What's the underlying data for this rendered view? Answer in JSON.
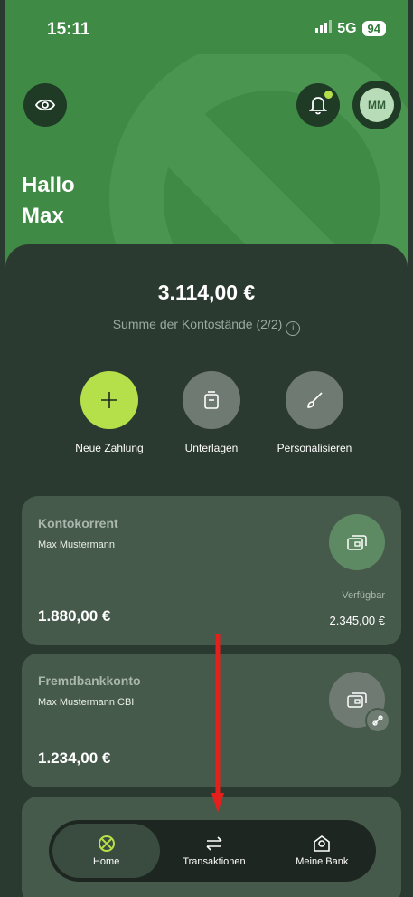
{
  "status": {
    "time": "15:11",
    "network": "5G",
    "battery": "94"
  },
  "header": {
    "avatar_initials": "MM",
    "greeting_line1": "Hallo",
    "greeting_line2": "Max"
  },
  "summary": {
    "total": "3.114,00 €",
    "label": "Summe der Kontostände (2/2)"
  },
  "actions": [
    {
      "label": "Neue Zahlung",
      "icon": "plus-icon"
    },
    {
      "label": "Unterlagen",
      "icon": "documents-icon"
    },
    {
      "label": "Personalisieren",
      "icon": "brush-icon"
    }
  ],
  "accounts": [
    {
      "title": "Kontokorrent",
      "owner": "Max Mustermann",
      "amount": "1.880,00 €",
      "available_label": "Verfügbar",
      "available_value": "2.345,00 €",
      "icon": "account-card-icon"
    },
    {
      "title": "Fremdbankkonto",
      "owner": "Max Mustermann CBI",
      "amount": "1.234,00 €",
      "icon": "account-card-icon",
      "badge_icon": "link-icon"
    }
  ],
  "nav": [
    {
      "label": "Home",
      "icon": "home-logo-icon",
      "active": true
    },
    {
      "label": "Transaktionen",
      "icon": "transfer-arrows-icon",
      "active": false
    },
    {
      "label": "Meine Bank",
      "icon": "bank-location-icon",
      "active": false
    }
  ],
  "colors": {
    "brand_green": "#3f8a45",
    "accent_lime": "#b6e04a",
    "panel": "#2b3a30",
    "card": "#465a4b",
    "annotation_arrow": "#e3201b"
  }
}
